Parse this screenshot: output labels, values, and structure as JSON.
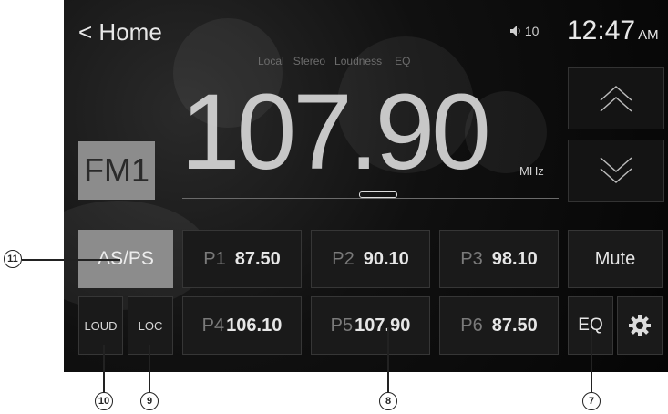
{
  "header": {
    "back_label": "Home",
    "volume_level": "10",
    "time": "12:47",
    "ampm": "AM"
  },
  "status_indicators": [
    "Local",
    "Stereo",
    "Loudness",
    "EQ"
  ],
  "tuner": {
    "frequency": "107.90",
    "unit": "MHz",
    "band": "FM1"
  },
  "buttons": {
    "as_ps": "AS/PS",
    "mute": "Mute",
    "loud": "LOUD",
    "loc": "LOC",
    "eq": "EQ"
  },
  "presets": [
    {
      "num": "P1",
      "freq": "87.50"
    },
    {
      "num": "P2",
      "freq": "90.10"
    },
    {
      "num": "P3",
      "freq": "98.10"
    },
    {
      "num": "P4",
      "freq": "106.10"
    },
    {
      "num": "P5",
      "freq": "107.90"
    },
    {
      "num": "P6",
      "freq": "87.50"
    }
  ],
  "callouts": {
    "c11": "11",
    "c10": "10",
    "c9": "9",
    "c8": "8",
    "c7": "7"
  },
  "icons": [
    "chevron-left-icon",
    "speaker-icon",
    "chevron-up-icon",
    "chevron-down-icon",
    "gear-icon"
  ]
}
